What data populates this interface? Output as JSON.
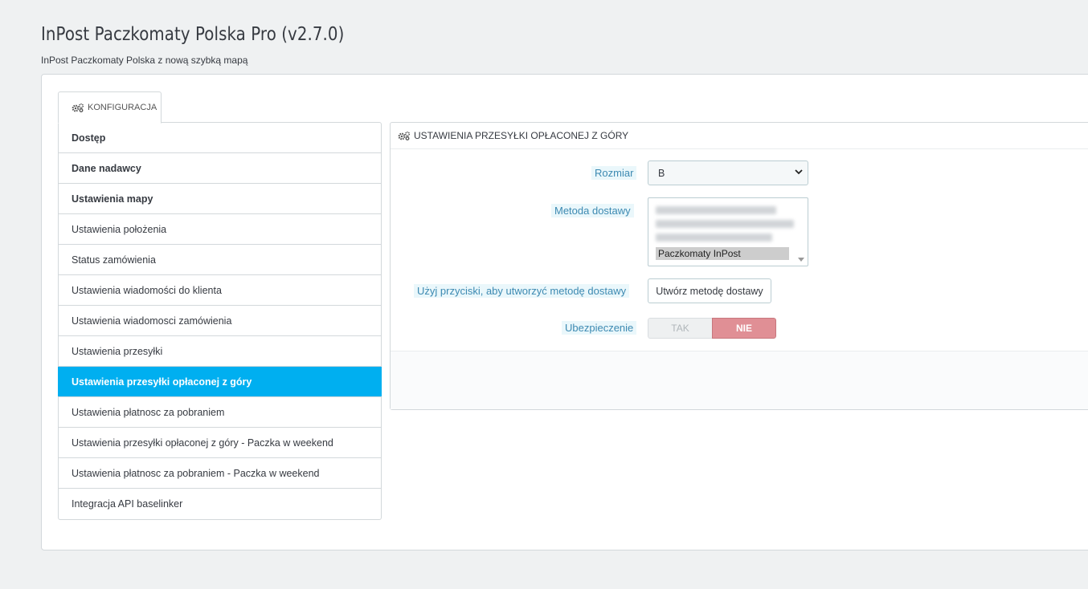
{
  "header": {
    "title": "InPost Paczkomaty Polska Pro (v2.7.0)",
    "subtitle": "InPost Paczkomaty Polska z nową szybką mapą"
  },
  "tab": {
    "label": "KONFIGURACJA",
    "icon": "gears-icon"
  },
  "sidebar": {
    "items": [
      {
        "label": "Dostęp",
        "bold": true
      },
      {
        "label": "Dane nadawcy",
        "bold": true
      },
      {
        "label": "Ustawienia mapy",
        "bold": true
      },
      {
        "label": "Ustawienia położenia"
      },
      {
        "label": "Status zamówienia"
      },
      {
        "label": "Ustawienia wiadomości do klienta"
      },
      {
        "label": "Ustawienia wiadomosci zamówienia"
      },
      {
        "label": "Ustawienia przesyłki"
      },
      {
        "label": "Ustawienia przesyłki opłaconej z góry",
        "active": true
      },
      {
        "label": "Ustawienia płatnosc za pobraniem"
      },
      {
        "label": "Ustawienia przesyłki opłaconej z góry - Paczka w weekend"
      },
      {
        "label": "Ustawienia płatnosc za pobraniem - Paczka w weekend"
      },
      {
        "label": "Integracja API baselinker"
      }
    ]
  },
  "form": {
    "heading": "USTAWIENIA PRZESYŁKI OPŁACONEJ Z GÓRY",
    "size_label": "Rozmiar",
    "size_value": "B",
    "method_label": "Metoda dostawy",
    "method_selected": "Paczkomaty InPost",
    "create_label": "Użyj przyciski, aby utworzyć metodę dostawy",
    "create_button": "Utwórz metodę dostawy",
    "insurance_label": "Ubezpieczenie",
    "insurance_yes": "TAK",
    "insurance_no": "NIE"
  },
  "colors": {
    "accent": "#00aff0",
    "switch_no": "#e08f95"
  }
}
